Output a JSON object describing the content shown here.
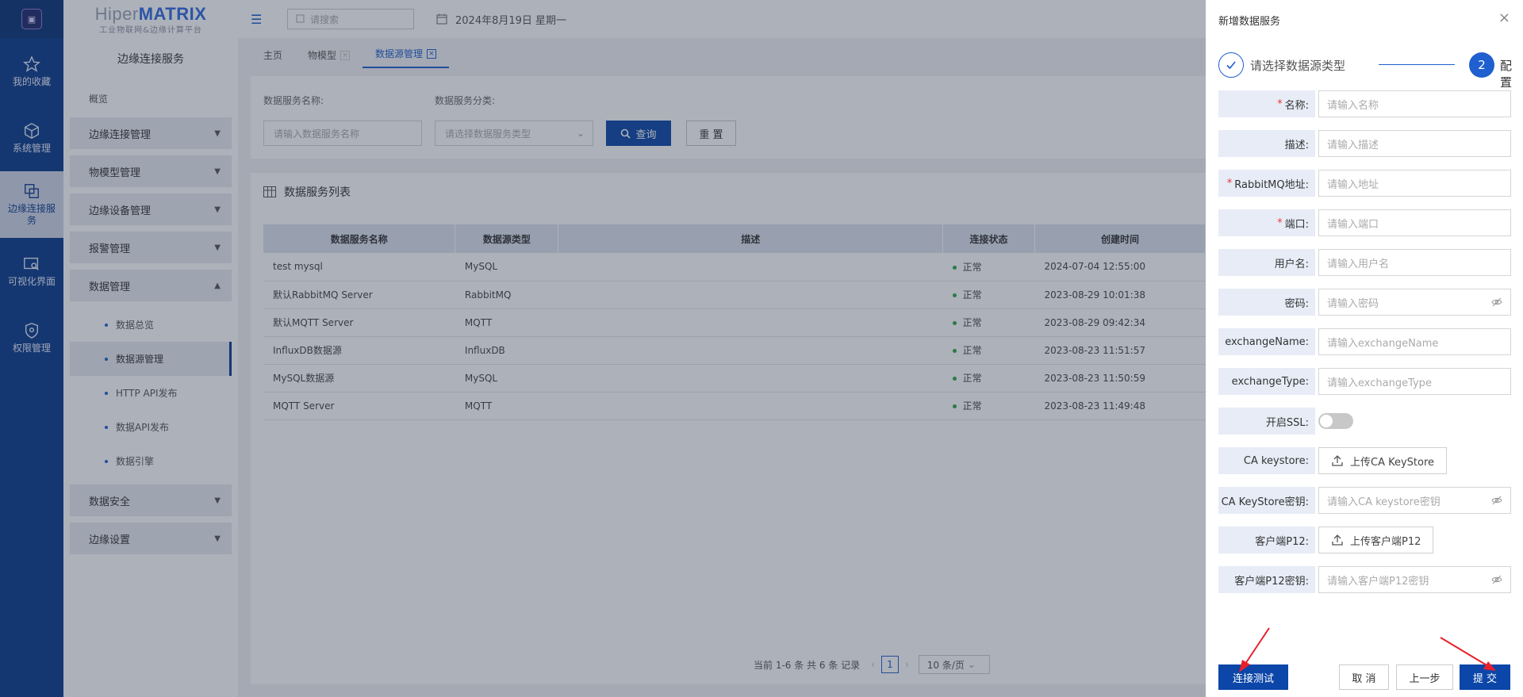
{
  "rail": {
    "items": [
      {
        "label": "我的收藏",
        "icon": "star-icon"
      },
      {
        "label": "系统管理",
        "icon": "cube-icon"
      },
      {
        "label": "边缘连接服务",
        "icon": "copy-icon"
      },
      {
        "label": "可视化界面",
        "icon": "image-search-icon"
      },
      {
        "label": "权限管理",
        "icon": "shield-icon"
      }
    ]
  },
  "brand": {
    "name_a": "Hiper",
    "name_b": "MATRIX",
    "tagline": "工业物联网&边缘计算平台"
  },
  "sidebar": {
    "title": "边缘连接服务",
    "overview": "概览",
    "groups": [
      {
        "label": "边缘连接管理"
      },
      {
        "label": "物模型管理"
      },
      {
        "label": "边缘设备管理"
      },
      {
        "label": "报警管理"
      },
      {
        "label": "数据管理"
      },
      {
        "label": "数据安全"
      },
      {
        "label": "边缘设置"
      }
    ],
    "sub_items": [
      {
        "label": "数据总览"
      },
      {
        "label": "数据源管理"
      },
      {
        "label": "HTTP API发布"
      },
      {
        "label": "数据API发布"
      },
      {
        "label": "数据引擎"
      }
    ]
  },
  "topbar": {
    "search_placeholder": "请搜索",
    "date": "2024年8月19日 星期一"
  },
  "tabs": [
    {
      "label": "主页"
    },
    {
      "label": "物模型",
      "close": "×"
    },
    {
      "label": "数据源管理",
      "close": "×"
    }
  ],
  "filter": {
    "name_label": "数据服务名称:",
    "name_placeholder": "请输入数据服务名称",
    "type_label": "数据服务分类:",
    "type_placeholder": "请选择数据服务类型",
    "query_button": "查询",
    "reset_button": "重 置"
  },
  "list": {
    "title": "数据服务列表",
    "columns": [
      "数据服务名称",
      "数据源类型",
      "描述",
      "连接状态",
      "创建时间"
    ],
    "rows": [
      {
        "name": "test mysql",
        "type": "MySQL",
        "desc": "",
        "status": "正常",
        "created": "2024-07-04 12:55:00"
      },
      {
        "name": "默认RabbitMQ Server",
        "type": "RabbitMQ",
        "desc": "",
        "status": "正常",
        "created": "2023-08-29 10:01:38"
      },
      {
        "name": "默认MQTT Server",
        "type": "MQTT",
        "desc": "",
        "status": "正常",
        "created": "2023-08-29 09:42:34"
      },
      {
        "name": "InfluxDB数据源",
        "type": "InfluxDB",
        "desc": "",
        "status": "正常",
        "created": "2023-08-23 11:51:57"
      },
      {
        "name": "MySQL数据源",
        "type": "MySQL",
        "desc": "",
        "status": "正常",
        "created": "2023-08-23 11:50:59"
      },
      {
        "name": "MQTT Server",
        "type": "MQTT",
        "desc": "",
        "status": "正常",
        "created": "2023-08-23 11:49:48"
      }
    ],
    "pager_text": "当前 1-6 条 共 6 条 记录",
    "page": "1",
    "page_size": "10 条/页"
  },
  "drawer": {
    "title": "新增数据服务",
    "close": "×",
    "step1_label": "请选择数据源类型",
    "step2_num": "2",
    "step2_label": "配置",
    "fields": [
      {
        "label": "名称:",
        "required": "*",
        "placeholder": "请输入名称"
      },
      {
        "label": "描述:",
        "required": "",
        "placeholder": "请输入描述"
      },
      {
        "label": "RabbitMQ地址:",
        "required": "*",
        "placeholder": "请输入地址"
      },
      {
        "label": "端口:",
        "required": "*",
        "placeholder": "请输入端口"
      },
      {
        "label": "用户名:",
        "required": "",
        "placeholder": "请输入用户名"
      },
      {
        "label": "密码:",
        "required": "",
        "placeholder": "请输入密码"
      },
      {
        "label": "exchangeName:",
        "required": "",
        "placeholder": "请输入exchangeName"
      },
      {
        "label": "exchangeType:",
        "required": "",
        "placeholder": "请输入exchangeType"
      },
      {
        "label": "开启SSL:",
        "required": ""
      },
      {
        "label": "CA keystore:",
        "required": "",
        "button": "上传CA KeyStore"
      },
      {
        "label": "CA KeyStore密钥:",
        "required": "",
        "placeholder": "请输入CA keystore密钥"
      },
      {
        "label": "客户端P12:",
        "required": "",
        "button": "上传客户端P12"
      },
      {
        "label": "客户端P12密钥:",
        "required": "",
        "placeholder": "请输入客户端P12密钥"
      }
    ],
    "ssl_enabled": false,
    "buttons": {
      "test": "连接测试",
      "cancel": "取 消",
      "prev": "上一步",
      "submit": "提 交"
    }
  },
  "colors": {
    "brand_blue": "#0b46a8",
    "rail": "#0b3a8c",
    "status_ok": "#2aa84a",
    "annotation_arrow": "#e8202a"
  }
}
